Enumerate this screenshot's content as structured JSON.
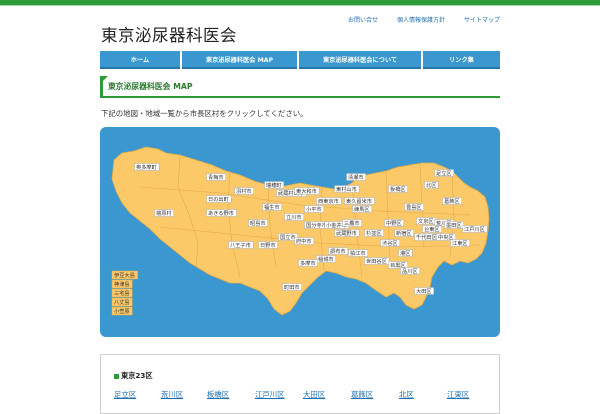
{
  "site": {
    "title": "東京泌尿器科医会"
  },
  "utility_links": [
    "お問い合せ",
    "個人情報保護方針",
    "サイトマップ"
  ],
  "nav": [
    "ホーム",
    "東京泌尿器科医会 MAP",
    "東京泌尿器科医会について",
    "リンク集"
  ],
  "section": {
    "heading": "東京泌尿器科医会 MAP"
  },
  "intro_text": "下記の地図・地域一覧から市長区村をクリックしてください。",
  "map": {
    "islands_labels": [
      "伊豆大島",
      "神津島",
      "三宅島",
      "八丈島",
      "小笠原"
    ],
    "labels": [
      "奥多摩町",
      "青梅市",
      "日の出町",
      "羽村市",
      "瑞穂町",
      "檜原村",
      "あきる野市",
      "福生市",
      "武蔵村山市",
      "東大和市",
      "清瀬市",
      "東村山市",
      "東久留米市",
      "西東京市",
      "小平市",
      "昭島市",
      "立川市",
      "国分寺市",
      "小金井市",
      "三鷹市",
      "武蔵野市",
      "八王子市",
      "日野市",
      "国立市",
      "府中市",
      "調布市",
      "狛江市",
      "稲城市",
      "多摩市",
      "町田市",
      "練馬区",
      "板橋区",
      "北区",
      "足立区",
      "葛飾区",
      "豊島区",
      "文京区",
      "荒川区",
      "台東区",
      "墨田区",
      "江戸川区",
      "中野区",
      "杉並区",
      "新宿区",
      "千代田区",
      "中央区",
      "江東区",
      "渋谷区",
      "港区",
      "世田谷区",
      "目黒区",
      "品川区",
      "大田区"
    ],
    "colors": {
      "sea": "#3a97cf",
      "land": "#fcc969"
    }
  },
  "ward_list": {
    "title": "東京23区",
    "items": [
      "足立区",
      "荒川区",
      "板橋区",
      "江戸川区",
      "大田区",
      "葛飾区",
      "北区",
      "江東区"
    ]
  }
}
